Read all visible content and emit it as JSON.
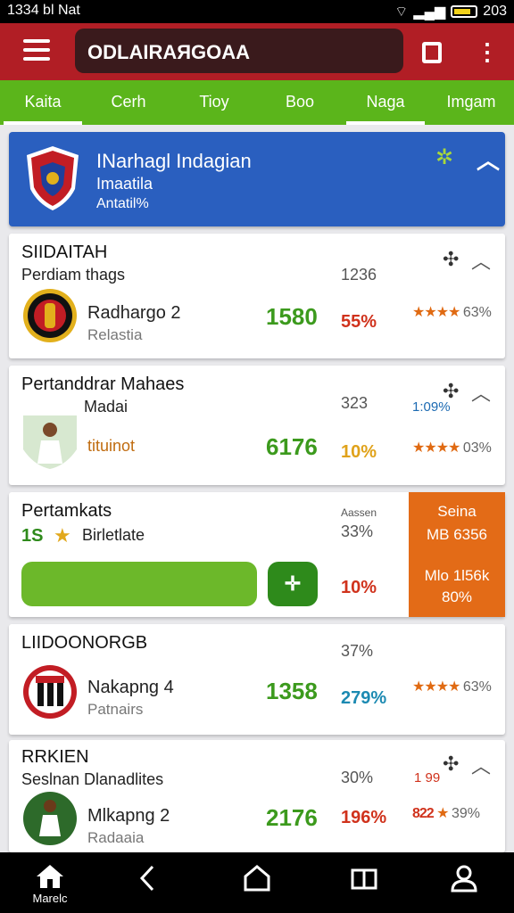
{
  "status": {
    "time": "1334 bl Nat",
    "right_text": "203"
  },
  "appbar": {
    "search_value": "ODLAIRAЯGOAA",
    "icons": [
      "menu-icon",
      "share-icon",
      "more-icon"
    ],
    "color": "#b11e25"
  },
  "tabs": [
    {
      "label": "Kaita",
      "active": true
    },
    {
      "label": "Cerh",
      "active": false
    },
    {
      "label": "Tioy",
      "active": false
    },
    {
      "label": "Boo",
      "active": false
    },
    {
      "label": "Naga",
      "active": true
    },
    {
      "label": "Imgam",
      "active": false
    }
  ],
  "hero": {
    "title": "INarhagl Indagian",
    "subtitle": "Imaatila",
    "meta": "Antatil%",
    "color": "#2a5fbf"
  },
  "cards": [
    {
      "header": "SIIDAITAH",
      "subheader": "Perdiam thags",
      "top_pct": "1236",
      "name": "Radhargo 2",
      "sub": "Relastia",
      "score": "1580",
      "pct": "55%",
      "stars": "★★★★",
      "star_pct": "63%"
    },
    {
      "header": "Pertanddrar Mahaes",
      "subheader": "Madai",
      "top_pct": "323",
      "extra": "1:09%",
      "caption": "tituinot",
      "score": "6176",
      "pct": "10%",
      "stars": "★★★★",
      "star_pct": "03%"
    },
    {
      "header": "Pertamkats",
      "subheader": "Birletlate",
      "sub_prefix": "1S",
      "top_small": "Aassen",
      "top_pct": "33%",
      "pct": "10%",
      "orange": {
        "line1": "Seina",
        "line2": "MB 6356",
        "line3": "Mlo 1l56k",
        "line4": "80%"
      },
      "pill_icon": "plus-icon"
    },
    {
      "header": "LIIDOONORGB",
      "top_pct": "37%",
      "name": "Nakapng 4",
      "sub": "Patnairs",
      "score": "1358",
      "pct": "279%",
      "stars": "★★★★",
      "star_pct": "63%"
    },
    {
      "header": "RRKIEN",
      "subheader": "Seslnan Dlanadlites",
      "top_pct": "30%",
      "extra": "1 99",
      "name": "Mlkapng 2",
      "sub": "Radaaia",
      "score": "2176",
      "pct": "196%",
      "stars_prefix": "822",
      "stars": "★",
      "star_pct": "39%"
    }
  ],
  "navbar": {
    "home_label": "Marelc",
    "icons": [
      "home-icon",
      "back-icon",
      "home-outline-icon",
      "recents-icon",
      "profile-icon"
    ]
  }
}
